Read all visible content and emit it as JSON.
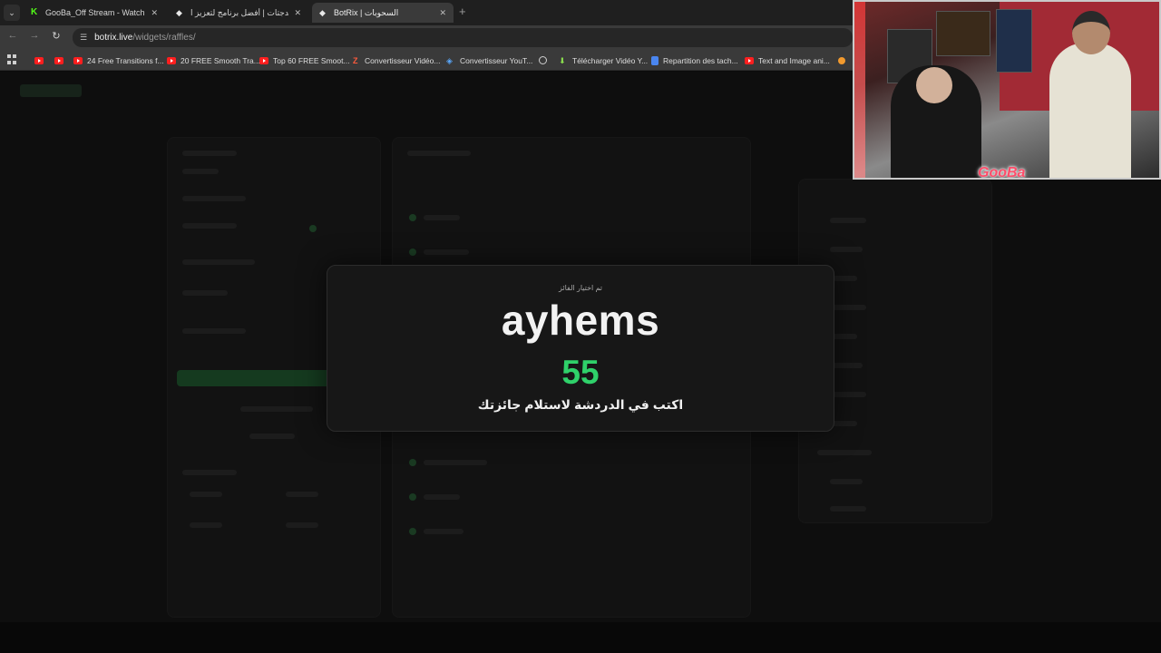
{
  "tabs": [
    {
      "title": "GooBa_Off Stream - Watch Live",
      "favicon": "kick-icon",
      "active": false
    },
    {
      "title": "الويدجتات | أفضل برنامج لتعزيز ا...",
      "favicon": "botrix-icon",
      "active": false
    },
    {
      "title": "BotRix | السحوبات",
      "favicon": "botrix-icon",
      "active": true
    }
  ],
  "address_bar": {
    "host": "botrix.live",
    "path": "/widgets/raffles/"
  },
  "bookmarks": [
    {
      "label": "",
      "icon": "youtube-icon"
    },
    {
      "label": "",
      "icon": "youtube-icon"
    },
    {
      "label": "24 Free Transitions f...",
      "icon": "youtube-icon"
    },
    {
      "label": "20 FREE Smooth Tra...",
      "icon": "youtube-icon"
    },
    {
      "label": "Top 60 FREE Smoot...",
      "icon": "youtube-icon"
    },
    {
      "label": "Convertisseur Vidéo...",
      "icon": "z-icon"
    },
    {
      "label": "Convertisseur YouT...",
      "icon": "converter-icon"
    },
    {
      "label": "",
      "icon": "globe-icon"
    },
    {
      "label": "Télécharger Vidéo Y...",
      "icon": "download-icon"
    },
    {
      "label": "Repartition des tach...",
      "icon": "docs-icon"
    },
    {
      "label": "Text and Image ani...",
      "icon": "youtube-icon"
    }
  ],
  "winner_modal": {
    "eyebrow": "تم اختيار الفائز",
    "winner_name": "ayhems",
    "count": "55",
    "instruction": "اكتب في الدردشة لاستلام جائزتك"
  },
  "webcam": {
    "overlay_label": "GooBa"
  },
  "colors": {
    "accent_green": "#2fd16a",
    "kick_green": "#53fc18"
  }
}
